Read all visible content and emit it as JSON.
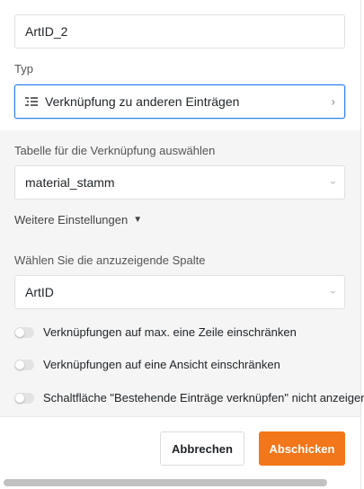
{
  "column_name": {
    "value": "ArtID_2"
  },
  "type": {
    "label": "Typ",
    "value": "Verknüpfung zu anderen Einträgen",
    "icon": "link-list-icon"
  },
  "link_table": {
    "label": "Tabelle für die Verknüpfung auswählen",
    "value": "material_stamm"
  },
  "more_settings": {
    "label": "Weitere Einstellungen"
  },
  "display_column": {
    "label": "Wählen Sie die anzuzeigende Spalte",
    "value": "ArtID"
  },
  "toggles": [
    {
      "label": "Verknüpfungen auf max. eine Zeile einschränken",
      "on": false
    },
    {
      "label": "Verknüpfungen auf eine Ansicht einschränken",
      "on": false
    },
    {
      "label": "Schaltfläche \"Bestehende Einträge verknüpfen\" nicht anzeigen",
      "on": false
    }
  ],
  "buttons": {
    "cancel": "Abbrechen",
    "submit": "Abschicken"
  },
  "colors": {
    "accent": "#2d7ff9",
    "submit": "#f2761a"
  }
}
